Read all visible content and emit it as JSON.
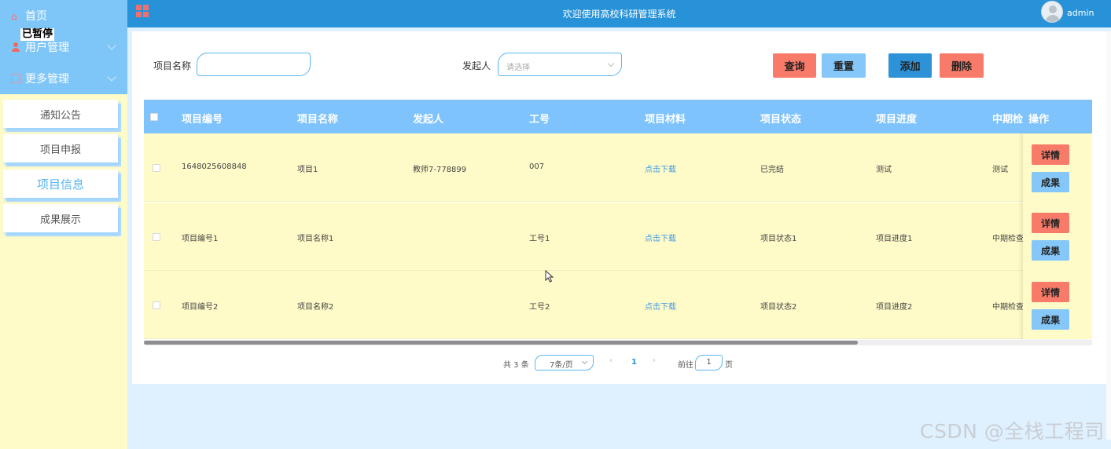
{
  "sidebar": {
    "home": "首页",
    "paused": "已暂停",
    "user_mgmt": "用户管理",
    "more_mgmt": "更多管理",
    "items": [
      {
        "label": "通知公告"
      },
      {
        "label": "项目申报"
      },
      {
        "label": "项目信息"
      },
      {
        "label": "成果展示"
      }
    ]
  },
  "topbar": {
    "title": "欢迎使用高校科研管理系统",
    "user": "admin"
  },
  "search": {
    "name_label": "项目名称",
    "name_value": "",
    "initiator_label": "发起人",
    "initiator_placeholder": "请选择",
    "query": "查询",
    "reset": "重置",
    "add": "添加",
    "delete": "删除"
  },
  "table": {
    "headers": [
      "项目编号",
      "项目名称",
      "发起人",
      "工号",
      "项目材料",
      "项目状态",
      "项目进度",
      "中期检",
      "操作"
    ],
    "rows": [
      {
        "no": "1648025608848",
        "name": "项目1",
        "initiator": "教师7-778899",
        "job_no": "007",
        "material": "点击下载",
        "status": "已完结",
        "progress": "测试",
        "midterm": "测试"
      },
      {
        "no": "项目编号1",
        "name": "项目名称1",
        "initiator": "",
        "job_no": "工号1",
        "material": "点击下载",
        "status": "项目状态1",
        "progress": "项目进度1",
        "midterm": "中期检查"
      },
      {
        "no": "项目编号2",
        "name": "项目名称2",
        "initiator": "",
        "job_no": "工号2",
        "material": "点击下载",
        "status": "项目状态2",
        "progress": "项目进度2",
        "midterm": "中期检查"
      }
    ],
    "detail": "详情",
    "result": "成果"
  },
  "pager": {
    "total": "共 3 条",
    "page_size": "7条/页",
    "current": "1",
    "goto_label": "前往",
    "goto_value": "1",
    "page_suffix": "页"
  },
  "watermark": "CSDN @全栈工程司",
  "colors": {
    "topbar": "#2892d8",
    "sidebar_head": "#7fc6f8",
    "sidebar_body": "#fffbc8",
    "table_head": "#7ec3fb",
    "button_red": "#f87a68",
    "button_blue": "#84c7f8",
    "button_dark_blue": "#2e92d8"
  }
}
